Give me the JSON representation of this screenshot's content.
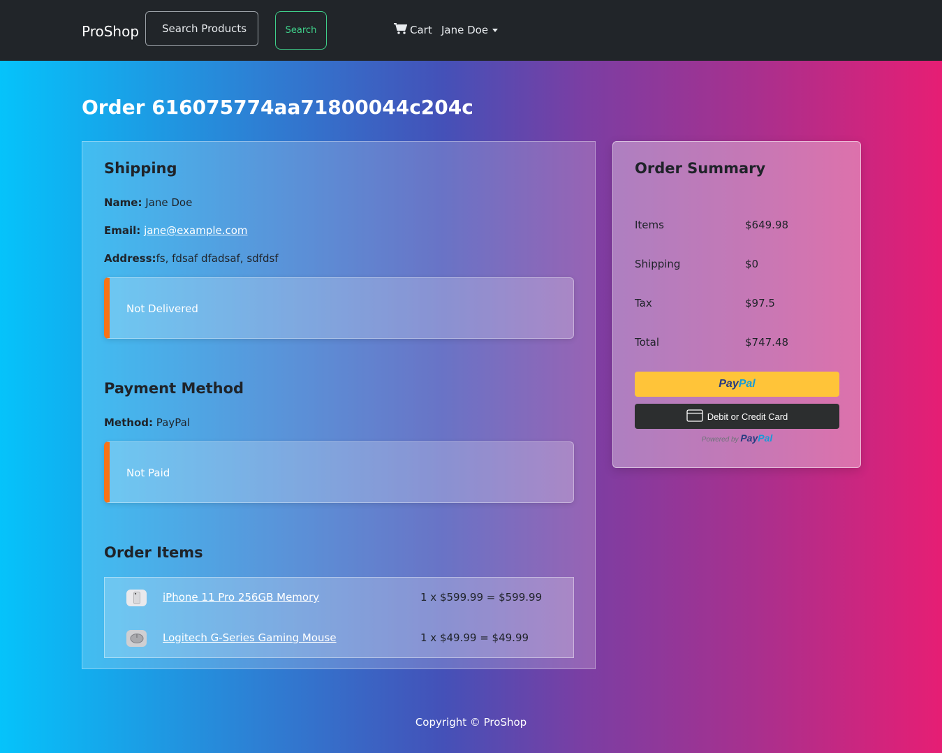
{
  "navbar": {
    "brand": "ProShop",
    "search_placeholder": "Search Products",
    "search_button": "Search",
    "cart_label": "Cart",
    "user_name": "Jane Doe"
  },
  "order": {
    "title": "Order 616075774aa71800044c204c"
  },
  "shipping": {
    "heading": "Shipping",
    "name_label": "Name:",
    "name_value": "Jane Doe",
    "email_label": "Email:",
    "email_value": "jane@example.com",
    "address_label": "Address:",
    "address_value": "fs, fdsaf dfadsaf, sdfdsf",
    "status": "Not Delivered"
  },
  "payment": {
    "heading": "Payment Method",
    "method_label": "Method:",
    "method_value": "PayPal",
    "status": "Not Paid"
  },
  "order_items": {
    "heading": "Order Items",
    "items": [
      {
        "name": "iPhone 11 Pro 256GB Memory",
        "price_line": "1 x $599.99 = $599.99"
      },
      {
        "name": "Logitech G-Series Gaming Mouse",
        "price_line": "1 x $49.99 = $49.99"
      }
    ]
  },
  "summary": {
    "heading": "Order Summary",
    "rows": [
      {
        "label": "Items",
        "value": "$649.98"
      },
      {
        "label": "Shipping",
        "value": "$0"
      },
      {
        "label": "Tax",
        "value": "$97.5"
      },
      {
        "label": "Total",
        "value": "$747.48"
      }
    ],
    "paypal_pay": "Pay",
    "paypal_pal": "Pal",
    "card_button": "Debit or Credit Card",
    "powered_by": "Powered by"
  },
  "footer": {
    "copyright": "Copyright © ProShop"
  },
  "colors": {
    "navbar_bg": "#212529",
    "search_accent": "#3fd08a",
    "alert_accent": "#f97316",
    "paypal_yellow": "#ffc439",
    "paypal_dark_blue": "#253b80",
    "paypal_light_blue": "#179bd7"
  }
}
